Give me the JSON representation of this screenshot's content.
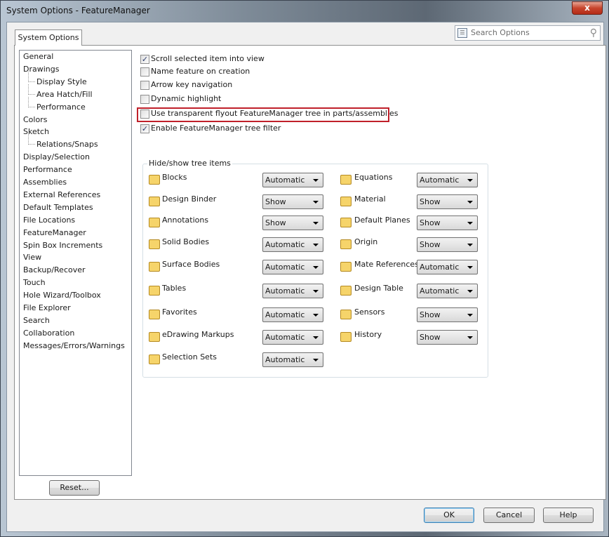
{
  "window": {
    "title": "System Options - FeatureManager",
    "close_label": "x"
  },
  "tab": "System Options",
  "search": {
    "placeholder": "Search Options"
  },
  "nav": [
    {
      "label": "General",
      "indent": 0
    },
    {
      "label": "Drawings",
      "indent": 0
    },
    {
      "label": "Display Style",
      "indent": 1
    },
    {
      "label": "Area Hatch/Fill",
      "indent": 1
    },
    {
      "label": "Performance",
      "indent": 1
    },
    {
      "label": "Colors",
      "indent": 0
    },
    {
      "label": "Sketch",
      "indent": 0
    },
    {
      "label": "Relations/Snaps",
      "indent": 1
    },
    {
      "label": "Display/Selection",
      "indent": 0
    },
    {
      "label": "Performance",
      "indent": 0
    },
    {
      "label": "Assemblies",
      "indent": 0
    },
    {
      "label": "External References",
      "indent": 0
    },
    {
      "label": "Default Templates",
      "indent": 0
    },
    {
      "label": "File Locations",
      "indent": 0
    },
    {
      "label": "FeatureManager",
      "indent": 0,
      "selected": true
    },
    {
      "label": "Spin Box Increments",
      "indent": 0
    },
    {
      "label": "View",
      "indent": 0
    },
    {
      "label": "Backup/Recover",
      "indent": 0
    },
    {
      "label": "Touch",
      "indent": 0
    },
    {
      "label": "Hole Wizard/Toolbox",
      "indent": 0
    },
    {
      "label": "File Explorer",
      "indent": 0
    },
    {
      "label": "Search",
      "indent": 0
    },
    {
      "label": "Collaboration",
      "indent": 0
    },
    {
      "label": "Messages/Errors/Warnings",
      "indent": 0
    }
  ],
  "checkboxes": [
    {
      "label": "Scroll selected item into view",
      "checked": true
    },
    {
      "label": "Name feature on creation",
      "checked": false
    },
    {
      "label": "Arrow key navigation",
      "checked": false
    },
    {
      "label": "Dynamic highlight",
      "checked": false
    },
    {
      "label": "Use transparent flyout FeatureManager tree in parts/assemblies",
      "checked": false,
      "highlighted": true
    },
    {
      "label": "Enable FeatureManager tree filter",
      "checked": true
    }
  ],
  "group_title": "Hide/show tree items",
  "tree_items_left": [
    {
      "label": "Blocks",
      "value": "Automatic",
      "icon": "blocks-folder-icon"
    },
    {
      "label": "Design Binder",
      "value": "Show",
      "icon": "design-binder-icon"
    },
    {
      "label": "Annotations",
      "value": "Show",
      "icon": "annotations-folder-icon"
    },
    {
      "label": "Solid Bodies",
      "value": "Automatic",
      "icon": "solid-bodies-folder-icon"
    },
    {
      "label": "Surface Bodies",
      "value": "Automatic",
      "icon": "surface-bodies-folder-icon"
    },
    {
      "label": "Tables",
      "value": "Automatic",
      "icon": "tables-folder-icon"
    },
    {
      "label": "Favorites",
      "value": "Automatic",
      "icon": "favorites-folder-icon"
    },
    {
      "label": "eDrawing Markups",
      "value": "Automatic",
      "icon": "edrawing-markups-icon"
    },
    {
      "label": "Selection Sets",
      "value": "Automatic",
      "icon": "selection-sets-folder-icon"
    }
  ],
  "tree_items_right": [
    {
      "label": "Equations",
      "value": "Automatic",
      "icon": "equations-folder-icon"
    },
    {
      "label": "Material",
      "value": "Show",
      "icon": "material-icon"
    },
    {
      "label": "Default Planes",
      "value": "Show",
      "icon": "default-planes-icon"
    },
    {
      "label": "Origin",
      "value": "Show",
      "icon": "origin-icon"
    },
    {
      "label": "Mate References",
      "value": "Automatic",
      "icon": "mate-references-folder-icon"
    },
    {
      "label": "Design Table",
      "value": "Automatic",
      "icon": "design-table-icon"
    },
    {
      "label": "Sensors",
      "value": "Show",
      "icon": "sensors-folder-icon"
    },
    {
      "label": "History",
      "value": "Show",
      "icon": "history-folder-icon"
    }
  ],
  "buttons": {
    "reset": "Reset...",
    "ok": "OK",
    "cancel": "Cancel",
    "help": "Help"
  },
  "colors": {
    "highlight_border": "#c0202a"
  }
}
